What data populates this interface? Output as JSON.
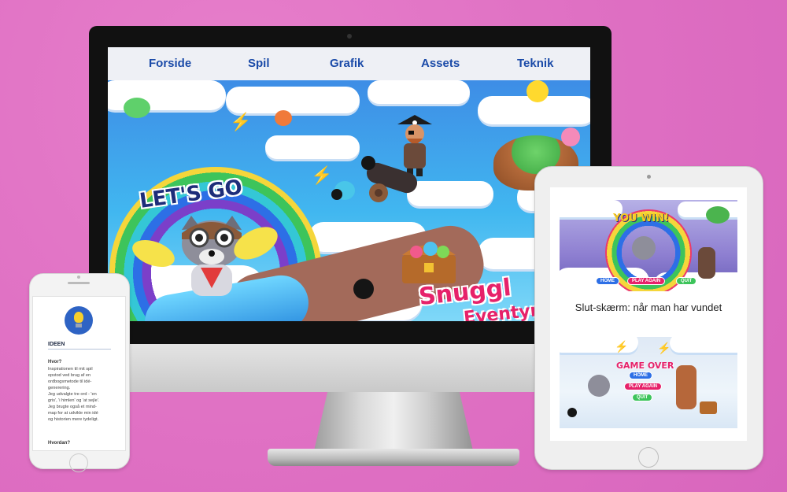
{
  "desktop": {
    "nav": [
      "Forside",
      "Spil",
      "Grafik",
      "Assets",
      "Teknik"
    ],
    "hero": {
      "tagline": "LET'S GO",
      "logo_title": "Snuggl",
      "logo_sub": "Eventyr"
    }
  },
  "phone": {
    "heading": "IDEEN",
    "question1": "Hvor?",
    "paragraph": [
      "Inspirationen til mit spil",
      "opstod ved brug af en",
      "ordbogsmetode til idé-",
      "generering.",
      "Jeg udvalgte tre ord - 'en",
      "gris', 'i himlen' og 'at sejle'.",
      "Jeg brugte også et mind-",
      "map for at udvikle min idé",
      "og historien mere tydeligt."
    ],
    "question2": "Hvordan?"
  },
  "tablet": {
    "win_screen": {
      "title": "YOU WIN!",
      "buttons": [
        "HOME",
        "PLAY AGAIN",
        "QUIT"
      ]
    },
    "caption": "Slut-skærm: når man har vundet",
    "lose_screen": {
      "title": "GAME OVER",
      "buttons": [
        "HOME",
        "PLAY AGAIN",
        "QUIT"
      ]
    }
  },
  "colors": {
    "background": "#e072c4",
    "nav_text": "#1a4aa8",
    "logo_pink": "#e6226a"
  }
}
